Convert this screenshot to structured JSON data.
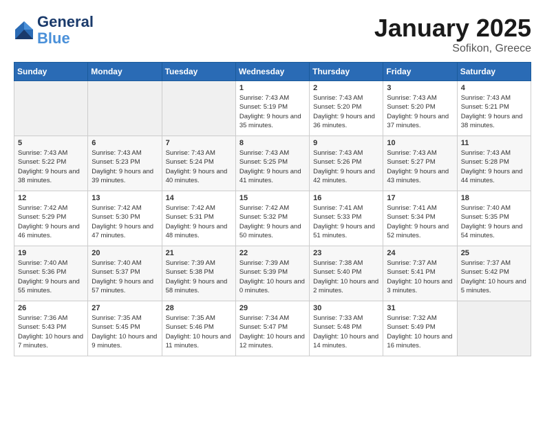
{
  "logo": {
    "line1": "General",
    "line2": "Blue"
  },
  "title": "January 2025",
  "subtitle": "Sofikon, Greece",
  "days_of_week": [
    "Sunday",
    "Monday",
    "Tuesday",
    "Wednesday",
    "Thursday",
    "Friday",
    "Saturday"
  ],
  "weeks": [
    [
      {
        "day": "",
        "info": ""
      },
      {
        "day": "",
        "info": ""
      },
      {
        "day": "",
        "info": ""
      },
      {
        "day": "1",
        "info": "Sunrise: 7:43 AM\nSunset: 5:19 PM\nDaylight: 9 hours and 35 minutes."
      },
      {
        "day": "2",
        "info": "Sunrise: 7:43 AM\nSunset: 5:20 PM\nDaylight: 9 hours and 36 minutes."
      },
      {
        "day": "3",
        "info": "Sunrise: 7:43 AM\nSunset: 5:20 PM\nDaylight: 9 hours and 37 minutes."
      },
      {
        "day": "4",
        "info": "Sunrise: 7:43 AM\nSunset: 5:21 PM\nDaylight: 9 hours and 38 minutes."
      }
    ],
    [
      {
        "day": "5",
        "info": "Sunrise: 7:43 AM\nSunset: 5:22 PM\nDaylight: 9 hours and 38 minutes."
      },
      {
        "day": "6",
        "info": "Sunrise: 7:43 AM\nSunset: 5:23 PM\nDaylight: 9 hours and 39 minutes."
      },
      {
        "day": "7",
        "info": "Sunrise: 7:43 AM\nSunset: 5:24 PM\nDaylight: 9 hours and 40 minutes."
      },
      {
        "day": "8",
        "info": "Sunrise: 7:43 AM\nSunset: 5:25 PM\nDaylight: 9 hours and 41 minutes."
      },
      {
        "day": "9",
        "info": "Sunrise: 7:43 AM\nSunset: 5:26 PM\nDaylight: 9 hours and 42 minutes."
      },
      {
        "day": "10",
        "info": "Sunrise: 7:43 AM\nSunset: 5:27 PM\nDaylight: 9 hours and 43 minutes."
      },
      {
        "day": "11",
        "info": "Sunrise: 7:43 AM\nSunset: 5:28 PM\nDaylight: 9 hours and 44 minutes."
      }
    ],
    [
      {
        "day": "12",
        "info": "Sunrise: 7:42 AM\nSunset: 5:29 PM\nDaylight: 9 hours and 46 minutes."
      },
      {
        "day": "13",
        "info": "Sunrise: 7:42 AM\nSunset: 5:30 PM\nDaylight: 9 hours and 47 minutes."
      },
      {
        "day": "14",
        "info": "Sunrise: 7:42 AM\nSunset: 5:31 PM\nDaylight: 9 hours and 48 minutes."
      },
      {
        "day": "15",
        "info": "Sunrise: 7:42 AM\nSunset: 5:32 PM\nDaylight: 9 hours and 50 minutes."
      },
      {
        "day": "16",
        "info": "Sunrise: 7:41 AM\nSunset: 5:33 PM\nDaylight: 9 hours and 51 minutes."
      },
      {
        "day": "17",
        "info": "Sunrise: 7:41 AM\nSunset: 5:34 PM\nDaylight: 9 hours and 52 minutes."
      },
      {
        "day": "18",
        "info": "Sunrise: 7:40 AM\nSunset: 5:35 PM\nDaylight: 9 hours and 54 minutes."
      }
    ],
    [
      {
        "day": "19",
        "info": "Sunrise: 7:40 AM\nSunset: 5:36 PM\nDaylight: 9 hours and 55 minutes."
      },
      {
        "day": "20",
        "info": "Sunrise: 7:40 AM\nSunset: 5:37 PM\nDaylight: 9 hours and 57 minutes."
      },
      {
        "day": "21",
        "info": "Sunrise: 7:39 AM\nSunset: 5:38 PM\nDaylight: 9 hours and 58 minutes."
      },
      {
        "day": "22",
        "info": "Sunrise: 7:39 AM\nSunset: 5:39 PM\nDaylight: 10 hours and 0 minutes."
      },
      {
        "day": "23",
        "info": "Sunrise: 7:38 AM\nSunset: 5:40 PM\nDaylight: 10 hours and 2 minutes."
      },
      {
        "day": "24",
        "info": "Sunrise: 7:37 AM\nSunset: 5:41 PM\nDaylight: 10 hours and 3 minutes."
      },
      {
        "day": "25",
        "info": "Sunrise: 7:37 AM\nSunset: 5:42 PM\nDaylight: 10 hours and 5 minutes."
      }
    ],
    [
      {
        "day": "26",
        "info": "Sunrise: 7:36 AM\nSunset: 5:43 PM\nDaylight: 10 hours and 7 minutes."
      },
      {
        "day": "27",
        "info": "Sunrise: 7:35 AM\nSunset: 5:45 PM\nDaylight: 10 hours and 9 minutes."
      },
      {
        "day": "28",
        "info": "Sunrise: 7:35 AM\nSunset: 5:46 PM\nDaylight: 10 hours and 11 minutes."
      },
      {
        "day": "29",
        "info": "Sunrise: 7:34 AM\nSunset: 5:47 PM\nDaylight: 10 hours and 12 minutes."
      },
      {
        "day": "30",
        "info": "Sunrise: 7:33 AM\nSunset: 5:48 PM\nDaylight: 10 hours and 14 minutes."
      },
      {
        "day": "31",
        "info": "Sunrise: 7:32 AM\nSunset: 5:49 PM\nDaylight: 10 hours and 16 minutes."
      },
      {
        "day": "",
        "info": ""
      }
    ]
  ]
}
